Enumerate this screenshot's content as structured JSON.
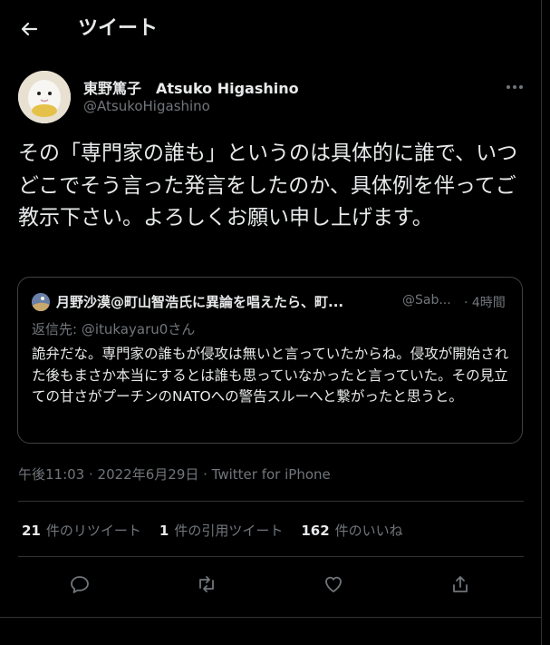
{
  "header": {
    "title": "ツイート",
    "back_icon": "arrow-left-icon"
  },
  "author": {
    "display_name": "東野篤子　Atsuko Higashino",
    "handle": "@AtsukoHigashino",
    "more_icon": "more-horizontal-icon"
  },
  "tweet": {
    "text": "その「専門家の誰も」というのは具体的に誰で、いつどこでそう言った発言をしたのか、具体例を伴ってご教示下さい。よろしくお願い申し上げます。"
  },
  "quoted_tweet": {
    "display_name": "月野沙漠@町山智浩氏に異論を唱えたら、町...",
    "handle": "@Sab...",
    "time": "· 4時間",
    "reply_prefix": "返信先: ",
    "reply_to": "@itukayaru0さん",
    "text": "詭弁だな。専門家の誰もが侵攻は無いと言っていたからね。侵攻が開始された後もまさか本当にするとは誰も思っていなかったと言っていた。その見立ての甘さがプーチンのNATOへの警告スルーへと繋がったと思うと。"
  },
  "meta": {
    "time": "午後11:03",
    "date": "· 2022年6月29日",
    "source": "· Twitter for iPhone"
  },
  "stats": {
    "retweets_count": "21",
    "retweets_label": "件のリツイート",
    "quotes_count": "1",
    "quotes_label": "件の引用ツイート",
    "likes_count": "162",
    "likes_label": "件のいいね"
  },
  "actions": {
    "reply_icon": "reply-icon",
    "retweet_icon": "retweet-icon",
    "like_icon": "heart-icon",
    "share_icon": "share-icon"
  },
  "colors": {
    "background": "#000000",
    "text": "#e7e9ea",
    "muted": "#71767b",
    "border": "#2f3336"
  }
}
